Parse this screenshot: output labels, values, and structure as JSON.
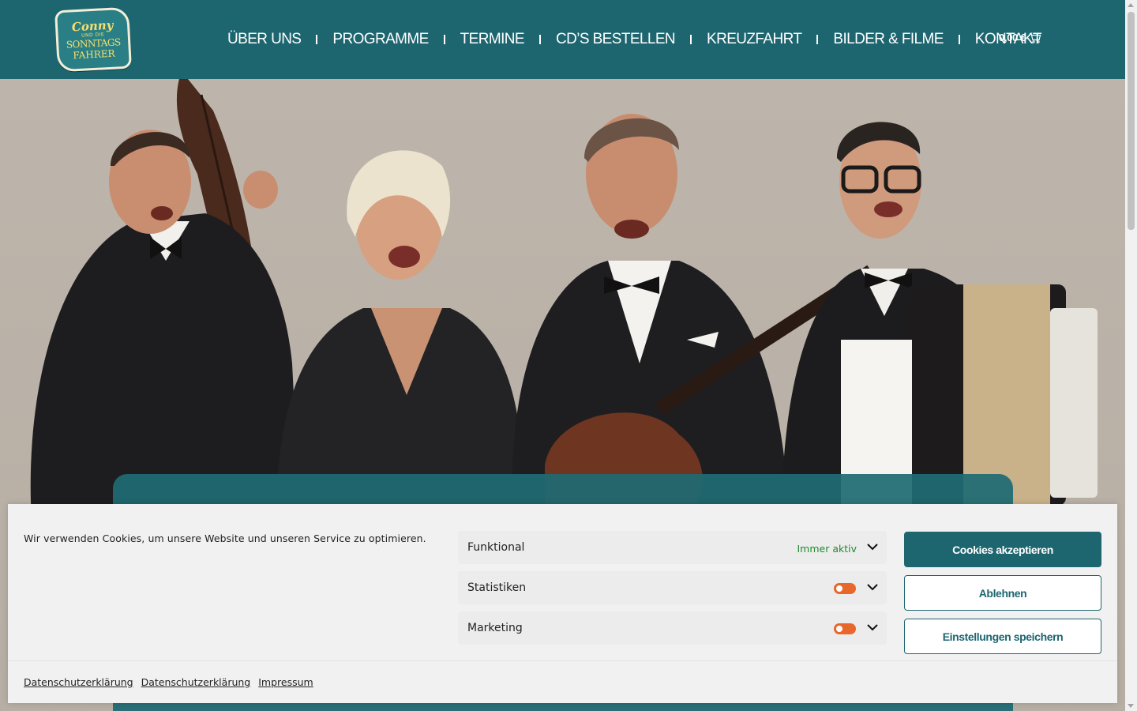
{
  "logo": {
    "line1": "Conny",
    "line2": "UND DIE",
    "line3": "SONNTAGS",
    "line4": "FAHRER"
  },
  "nav": {
    "items": [
      "ÜBER UNS",
      "PROGRAMME",
      "TERMINE",
      "CD’S BESTELLEN",
      "KREUZFAHRT",
      "BILDER & FILME",
      "KONTAKT"
    ]
  },
  "cart": {
    "amount": "0,00 €",
    "icon": "cart-icon"
  },
  "cookie": {
    "message": "Wir verwenden Cookies, um unsere Website und unseren Service zu optimieren.",
    "categories": [
      {
        "name": "Funktional",
        "status": "Immer aktiv"
      },
      {
        "name": "Statistiken"
      },
      {
        "name": "Marketing"
      }
    ],
    "buttons": {
      "accept": "Cookies akzeptieren",
      "deny": "Ablehnen",
      "save": "Einstellungen speichern"
    },
    "links": [
      "Datenschutzerklärung",
      "Datenschutzerklärung",
      "Impressum"
    ]
  },
  "colors": {
    "brand": "#1d6670",
    "toggle": "#e8672b",
    "always_active": "#1e8a2e"
  }
}
